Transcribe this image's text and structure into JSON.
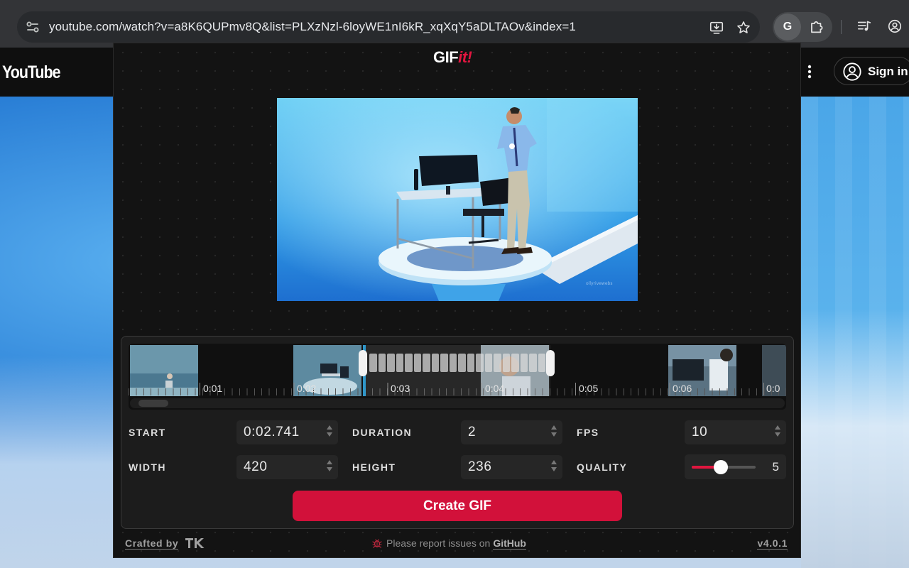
{
  "browser": {
    "url": "youtube.com/watch?v=a8K6QUPmv8Q&list=PLXzNzl-6loyWE1nI6kR_xqXqY5aDLTAOv&index=1",
    "extension_letter": "G"
  },
  "youtube": {
    "logo": "YouTube",
    "sign_in_label": "Sign in"
  },
  "gifit": {
    "logo_main": "GIF",
    "logo_accent": "it!",
    "timeline": {
      "tick_labels": [
        "0:01",
        "0:02",
        "0:03",
        "0:04",
        "0:05",
        "0:06",
        "0:0"
      ]
    },
    "fields": {
      "start": {
        "label": "START",
        "value": "0:02.741"
      },
      "duration": {
        "label": "DURATION",
        "value": "2"
      },
      "fps": {
        "label": "FPS",
        "value": "10"
      },
      "width": {
        "label": "WIDTH",
        "value": "420"
      },
      "height": {
        "label": "HEIGHT",
        "value": "236"
      },
      "quality": {
        "label": "QUALITY",
        "value": "5",
        "level": 0.45
      }
    },
    "create_label": "Create GIF",
    "footer": {
      "crafted_by": "Crafted by",
      "report_text": "Please report issues on",
      "report_link": "GitHub",
      "version": "v4.0.1"
    }
  },
  "colors": {
    "accent": "#d2113a",
    "panel_bg": "#131313",
    "browser_toolbar": "#333437"
  }
}
